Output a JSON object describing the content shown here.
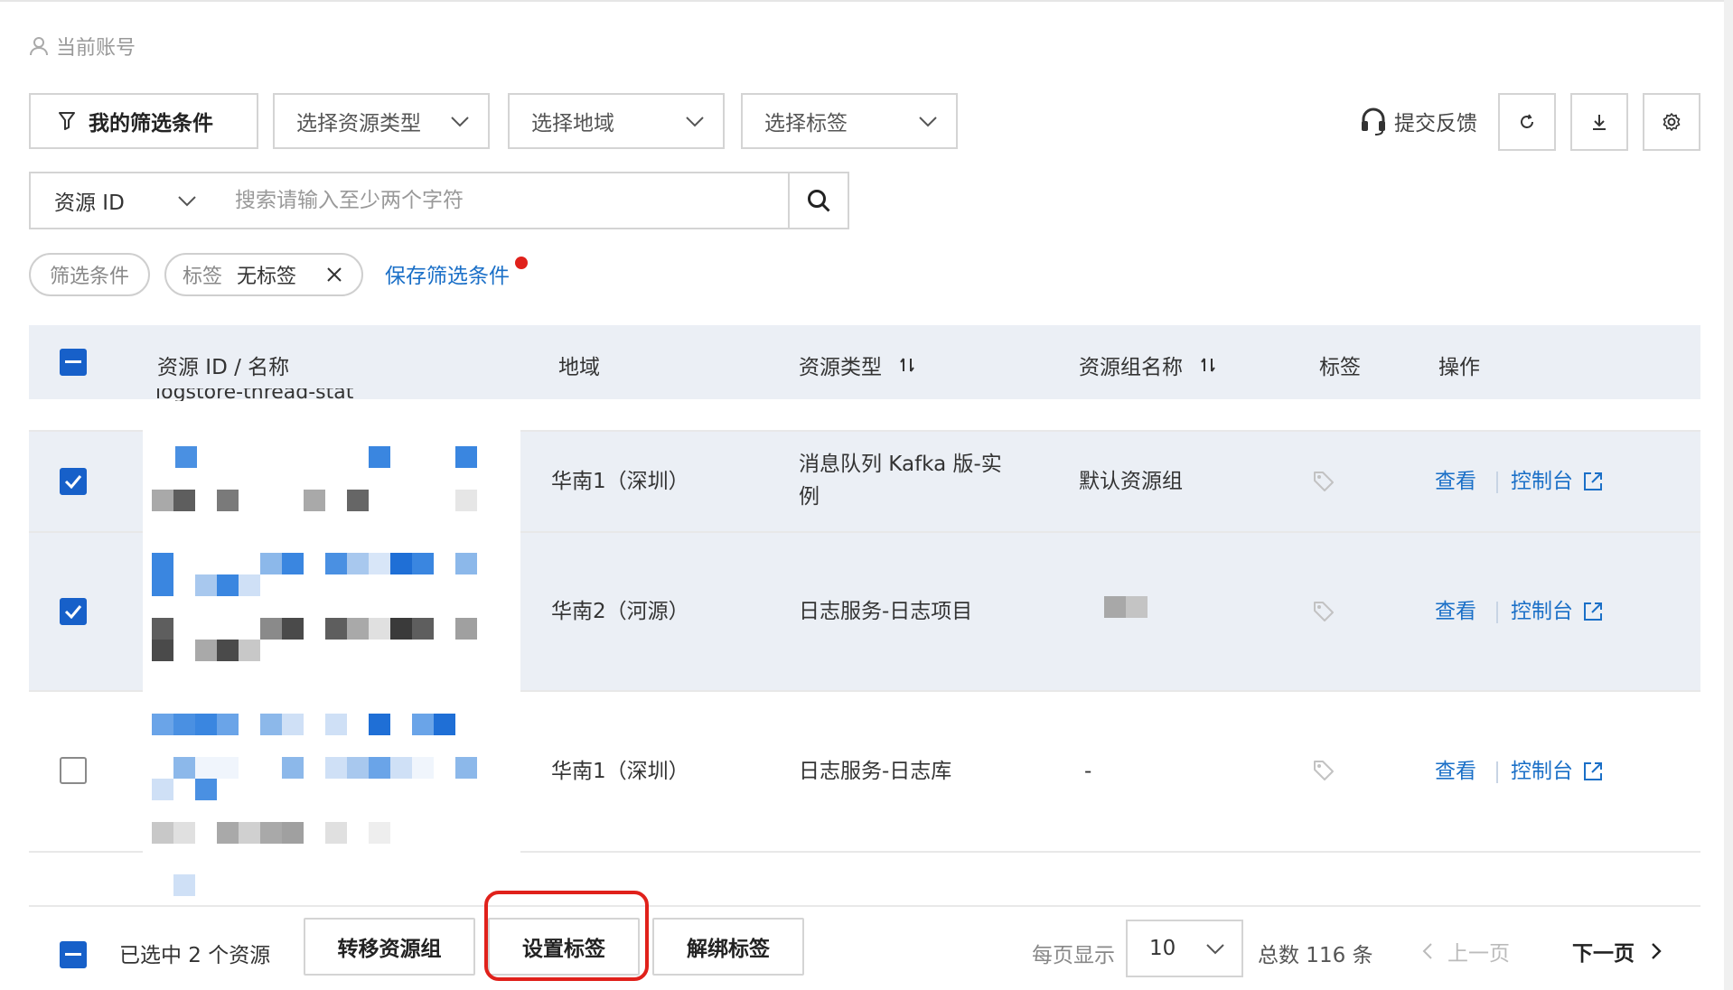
{
  "account_label": "当前账号",
  "toolbar": {
    "my_filters": "我的筛选条件",
    "resource_type_placeholder": "选择资源类型",
    "region_placeholder": "选择地域",
    "tag_placeholder": "选择标签",
    "feedback": "提交反馈"
  },
  "search": {
    "type_value": "资源 ID",
    "placeholder": "搜索请输入至少两个字符"
  },
  "filters": {
    "label": "筛选条件",
    "tag_key": "标签",
    "tag_value": "无标签",
    "save": "保存筛选条件"
  },
  "table": {
    "headers": [
      "资源 ID / 名称",
      "地域",
      "资源类型",
      "资源组名称",
      "标签",
      "操作"
    ],
    "partial_row_text": "logstore-thread-stat",
    "rows": [
      {
        "region": "华南1（深圳）",
        "type_line1": "消息队列 Kafka 版-实",
        "type_line2": "例",
        "group": "默认资源组",
        "view": "查看",
        "console": "控制台",
        "checked": true
      },
      {
        "region": "华南2（河源）",
        "type_line1": "日志服务-日志项目",
        "type_line2": "",
        "group": "",
        "view": "查看",
        "console": "控制台",
        "checked": true
      },
      {
        "region": "华南1（深圳）",
        "type_line1": "日志服务-日志库",
        "type_line2": "",
        "group": "-",
        "view": "查看",
        "console": "控制台",
        "checked": false
      }
    ]
  },
  "footer": {
    "selected": "已选中 2 个资源",
    "move_group": "转移资源组",
    "set_tag": "设置标签",
    "unbind_tag": "解绑标签",
    "per_page_label": "每页显示",
    "per_page_value": "10",
    "total": "总数 116 条",
    "prev": "上一页",
    "next": "下一页"
  },
  "colors": {
    "primary": "#1760c9",
    "link": "#1a6fc7",
    "highlight": "#e0211b",
    "row_selected_bg": "#ebeff5"
  }
}
